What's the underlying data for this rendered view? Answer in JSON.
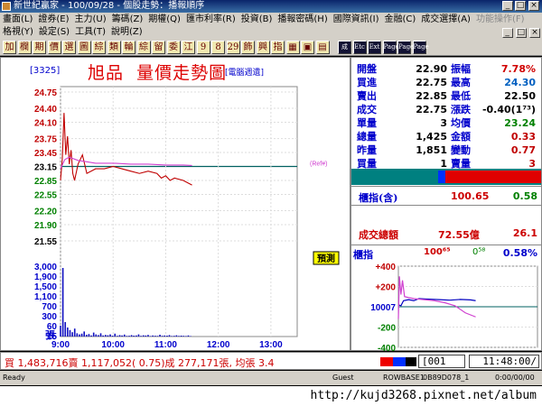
{
  "window": {
    "title": "新世紀贏家 - 100/09/28 - 個股走勢：播報順序",
    "buttons": [
      "_",
      "□",
      "×"
    ]
  },
  "menu": {
    "row1": [
      "畫面(L)",
      "證券(E)",
      "主力(U)",
      "籌碼(Z)",
      "期權(Q)",
      "匯市利率(R)",
      "投資(B)",
      "播報密碼(H)",
      "國際資訊(I)",
      "金融(C)",
      "成交選擇(A)"
    ],
    "row1_dim": [
      "功能操作(F)"
    ],
    "row2": [
      "格視(Y)",
      "設定(S)",
      "工具(T)",
      "說明(Z)"
    ]
  },
  "toolbar": {
    "buttons": [
      "加",
      "欄",
      "期",
      "價",
      "選",
      "圖",
      "綜",
      "類",
      "輪",
      "綜",
      "留",
      "委",
      "江",
      "9",
      "8",
      "29",
      "飾",
      "興",
      "指",
      "▦",
      "▣",
      "▤",
      "成",
      "Etc",
      "Ext",
      "Page",
      "Page",
      "Page"
    ]
  },
  "chart": {
    "code": "[3325]",
    "name": "旭品",
    "title": "量價走勢圖",
    "tag": "[電腦週遺]",
    "ref_tag": "(Ref#)",
    "pred_label": "預測",
    "vol_unit": "張",
    "ref_price_label": "21.55"
  },
  "chart_data": [
    {
      "type": "line",
      "title": "量價走勢圖",
      "ylim": [
        21.55,
        24.75
      ],
      "yticks": [
        "24.75",
        "24.40",
        "24.10",
        "23.75",
        "23.45",
        "23.15",
        "22.85",
        "22.55",
        "22.20",
        "21.90",
        "21.55"
      ],
      "xticks": [
        "9:00",
        "10:00",
        "11:00",
        "12:00",
        "13:00"
      ],
      "reference_price": 23.15,
      "series": [
        {
          "name": "price",
          "color": "#c00000",
          "x": [
            0,
            2,
            4,
            6,
            8,
            10,
            12,
            14,
            16,
            20,
            25,
            30,
            40,
            50,
            60,
            70,
            80,
            90,
            100,
            110,
            115,
            120,
            125,
            130,
            140,
            150
          ],
          "y": [
            22.85,
            23.3,
            24.3,
            23.4,
            23.8,
            23.2,
            23.5,
            23.0,
            22.85,
            23.2,
            23.4,
            23.0,
            23.1,
            23.1,
            23.15,
            23.1,
            23.05,
            23.0,
            23.05,
            23.0,
            22.9,
            22.95,
            22.85,
            22.9,
            22.85,
            22.75
          ]
        },
        {
          "name": "average",
          "color": "#d040d0",
          "x": [
            0,
            5,
            10,
            20,
            30,
            40,
            60,
            80,
            100,
            120,
            140,
            150
          ],
          "y": [
            23.1,
            23.3,
            23.35,
            23.28,
            23.25,
            23.22,
            23.22,
            23.2,
            23.2,
            23.18,
            23.18,
            23.17
          ]
        }
      ],
      "x_range_minutes": [
        0,
        270
      ]
    },
    {
      "type": "bar",
      "title": "",
      "ylim": [
        0,
        3000
      ],
      "yticks": [
        "3,000",
        "1,900",
        "1,500",
        "1,100",
        "700",
        "300",
        "60",
        "15"
      ],
      "volume_note": "minute volume bars (approx.)",
      "values": [
        300,
        1900,
        400,
        250,
        180,
        120,
        220,
        90,
        60,
        80,
        140,
        50,
        70,
        30,
        110,
        60,
        40,
        90,
        30,
        45,
        35,
        60,
        25,
        80,
        20,
        40,
        30,
        55,
        18,
        22,
        40,
        25,
        30,
        60,
        20,
        35,
        28,
        45,
        15,
        30,
        22,
        18,
        50,
        20,
        30,
        25,
        40,
        15,
        20,
        35,
        18,
        25,
        20,
        15,
        30,
        12
      ]
    },
    {
      "type": "line",
      "title": "",
      "ylim": [
        -400,
        400
      ],
      "yticks": [
        "+400",
        "+200",
        "10007",
        "-200",
        "-400"
      ],
      "series": [
        {
          "name": "index",
          "color": "#0000c0",
          "x": [
            0,
            5,
            10,
            20,
            30,
            40,
            60,
            80,
            100,
            120,
            140,
            150
          ],
          "y": [
            20,
            10,
            60,
            70,
            60,
            80,
            75,
            70,
            65,
            72,
            68,
            60
          ]
        },
        {
          "name": "index_avg",
          "color": "#d040d0",
          "x": [
            0,
            2,
            5,
            8,
            12,
            20,
            30,
            50,
            70,
            90,
            110,
            130,
            150
          ],
          "y": [
            -120,
            300,
            120,
            260,
            100,
            90,
            80,
            70,
            60,
            40,
            10,
            -60,
            -100
          ]
        }
      ],
      "x_range_minutes": [
        0,
        270
      ]
    }
  ],
  "info": {
    "rows": [
      {
        "l1": "開盤",
        "v1": "22.90",
        "l2": "振幅",
        "v2": "7.78%",
        "c2": "#d00000"
      },
      {
        "l1": "買進",
        "v1": "22.75",
        "l2": "最高",
        "v2": "24.30",
        "c2": "#0060c0"
      },
      {
        "l1": "賣出",
        "v1": "22.85",
        "l2": "最低",
        "v2": "22.50",
        "c2": "#000000"
      },
      {
        "l1": "成交",
        "v1": "22.75",
        "l2": "漲跌",
        "v2": "-0.40(1⁷³)",
        "c2": "#000000"
      },
      {
        "l1": "單量",
        "v1": "3",
        "l2": "均價",
        "v2": "23.24",
        "c2": "#008000"
      },
      {
        "l1": "總量",
        "v1": "1,425",
        "l2": "金額",
        "v2": "0.33",
        "c2": "#c00000"
      },
      {
        "l1": "昨量",
        "v1": "1,851",
        "l2": "變動",
        "v2": "0.77",
        "c2": "#c00000"
      },
      {
        "l1": "買量",
        "v1": "1",
        "l2": "賣量",
        "v2": "3",
        "c2": "#c00000"
      }
    ],
    "index_label": "櫃指(含)",
    "index_value": "100.65",
    "index_change": "0.58",
    "turnover_label": "成交總額",
    "turnover_value": "72.55億",
    "turnover_change": "26.1",
    "mini_title": "櫃指",
    "mini_value": "100⁶⁵",
    "mini_change": "0⁵⁸",
    "mini_pct": "0.58%"
  },
  "status": {
    "summary": "買 1,483,716賣 1,117,052( 0.75)成 277,171張, 均張 3.4",
    "page": "001",
    "clock": "11:48:00/"
  },
  "taskbar": [
    "Ready",
    "Guest",
    "ROWBASE1",
    "0B89D078_1",
    "0:00/00/00"
  ],
  "footer": {
    "url": "http://kujd3268.pixnet.net/album"
  },
  "colors": {
    "bg": "#000000",
    "accent": "#0000cc",
    "up": "#d00000",
    "down": "#008000"
  }
}
